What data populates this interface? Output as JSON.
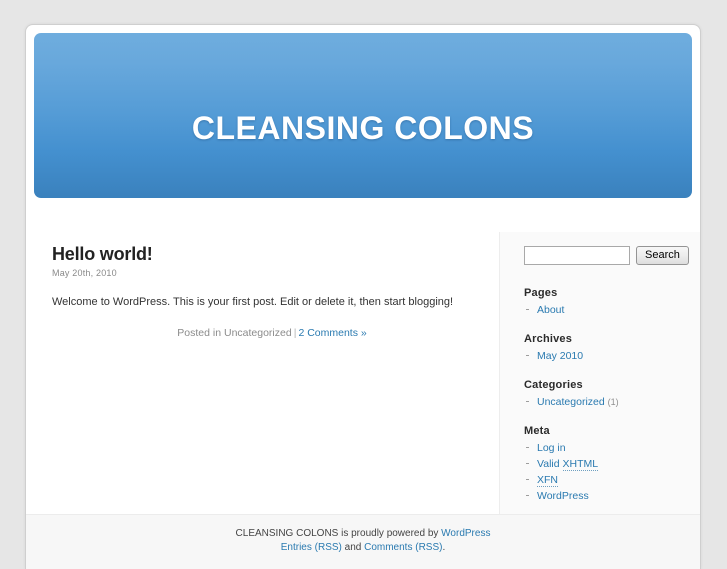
{
  "site": {
    "title": "CLEANSING COLONS",
    "description": ""
  },
  "post": {
    "title": "Hello world!",
    "date": "May 20th, 2010",
    "body": "Welcome to WordPress. This is your first post. Edit or delete it, then start blogging!",
    "meta_prefix": "Posted in ",
    "category": "Uncategorized",
    "separator": "|",
    "comments_link": "2 Comments »"
  },
  "search": {
    "value": "",
    "placeholder": "",
    "button_label": "Search"
  },
  "sidebar": {
    "widgets": [
      {
        "title": "Pages",
        "items": [
          {
            "label": "About",
            "count": ""
          }
        ]
      },
      {
        "title": "Archives",
        "items": [
          {
            "label": "May 2010",
            "count": ""
          }
        ]
      },
      {
        "title": "Categories",
        "items": [
          {
            "label": "Uncategorized",
            "count": "(1)"
          }
        ]
      },
      {
        "title": "Meta",
        "items": [
          {
            "label": "Log in",
            "count": ""
          },
          {
            "label": "Valid XHTML",
            "count": ""
          },
          {
            "label": "XFN",
            "count": ""
          },
          {
            "label": "WordPress",
            "count": ""
          }
        ]
      }
    ]
  },
  "footer": {
    "line1_prefix": "CLEANSING COLONS is proudly powered by ",
    "line1_link": "WordPress",
    "line2_link1": "Entries (RSS)",
    "line2_mid": " and ",
    "line2_link2": "Comments (RSS)",
    "line2_suffix": "."
  },
  "colors": {
    "page_background": "#e6e6e6",
    "header_gradient_top": "#6fadde",
    "header_gradient_bottom": "#3a81bd",
    "link": "#2a7ab0",
    "sidebar_background": "#fafafa",
    "footer_background": "#f7f7f7"
  }
}
